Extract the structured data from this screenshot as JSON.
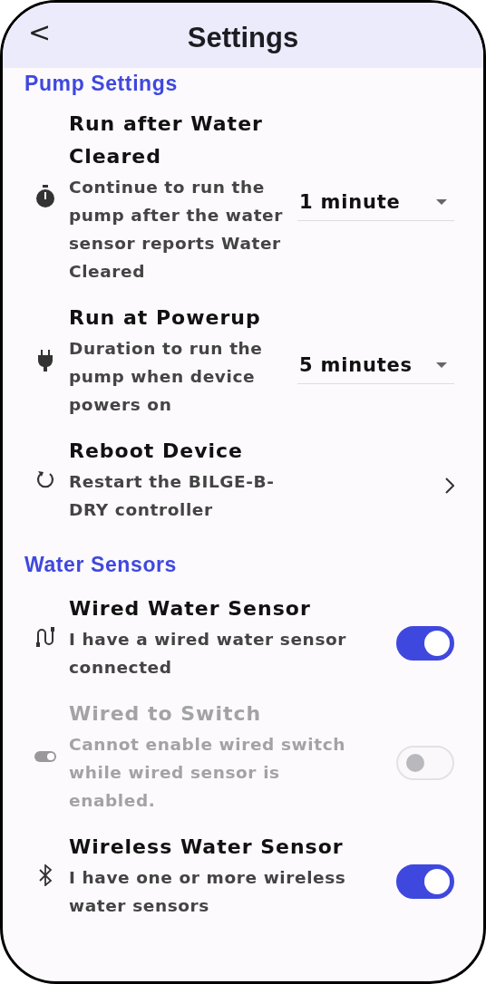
{
  "header": {
    "back": "<",
    "title": "Settings"
  },
  "sections": [
    {
      "title": "Pump Settings",
      "items": [
        {
          "kind": "dropdown",
          "title": "Run after Water Cleared",
          "description": "Continue to run the pump after the water sensor reports Water Cleared",
          "value": "1 minute",
          "disabled": false
        },
        {
          "kind": "dropdown",
          "title": "Run at Powerup",
          "description": "Duration to run the pump when device powers on",
          "value": "5 minutes",
          "disabled": false
        },
        {
          "kind": "link",
          "title": "Reboot Device",
          "description": "Restart the BILGE-B-DRY controller",
          "disabled": false
        }
      ]
    },
    {
      "title": "Water Sensors",
      "items": [
        {
          "kind": "toggle",
          "title": "Wired Water Sensor",
          "description": "I have a wired water sensor connected",
          "on": true,
          "disabled": false
        },
        {
          "kind": "toggle",
          "title": "Wired to Switch",
          "description": "Cannot enable wired switch while wired sensor is enabled.",
          "on": false,
          "disabled": true
        },
        {
          "kind": "toggle",
          "title": "Wireless Water Sensor",
          "description": "I have one or more wireless water sensors",
          "on": true,
          "disabled": false
        }
      ]
    }
  ]
}
